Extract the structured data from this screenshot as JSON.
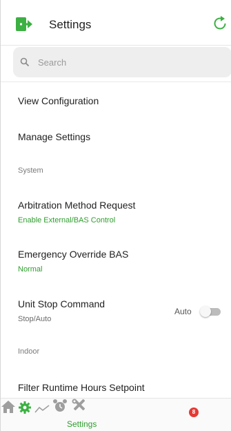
{
  "header": {
    "title": "Settings",
    "logout_icon": "logout-icon",
    "refresh_icon": "refresh-icon"
  },
  "search": {
    "placeholder": "Search",
    "value": ""
  },
  "menu": {
    "view_configuration": "View Configuration",
    "manage_settings": "Manage Settings"
  },
  "sections": {
    "system": "System",
    "indoor": "Indoor"
  },
  "settings": [
    {
      "label": "Arbitration Method Request",
      "value": "Enable External/BAS Control"
    },
    {
      "label": "Emergency Override BAS",
      "value": "Normal"
    },
    {
      "label": "Unit Stop Command",
      "value": "Stop/Auto",
      "toggle_label": "Auto",
      "toggle_on": false
    },
    {
      "label": "Filter Runtime Hours Setpoint"
    }
  ],
  "bottom_nav": {
    "items": [
      {
        "icon": "home-icon",
        "label": ""
      },
      {
        "icon": "gear-icon",
        "label": "Settings",
        "active": true
      },
      {
        "icon": "trend-icon",
        "label": ""
      },
      {
        "icon": "alarm-clock-icon",
        "label": "",
        "badge": "8"
      },
      {
        "icon": "tools-icon",
        "label": ""
      }
    ]
  },
  "colors": {
    "accent": "#2e9e2e",
    "badge": "#e53935"
  }
}
